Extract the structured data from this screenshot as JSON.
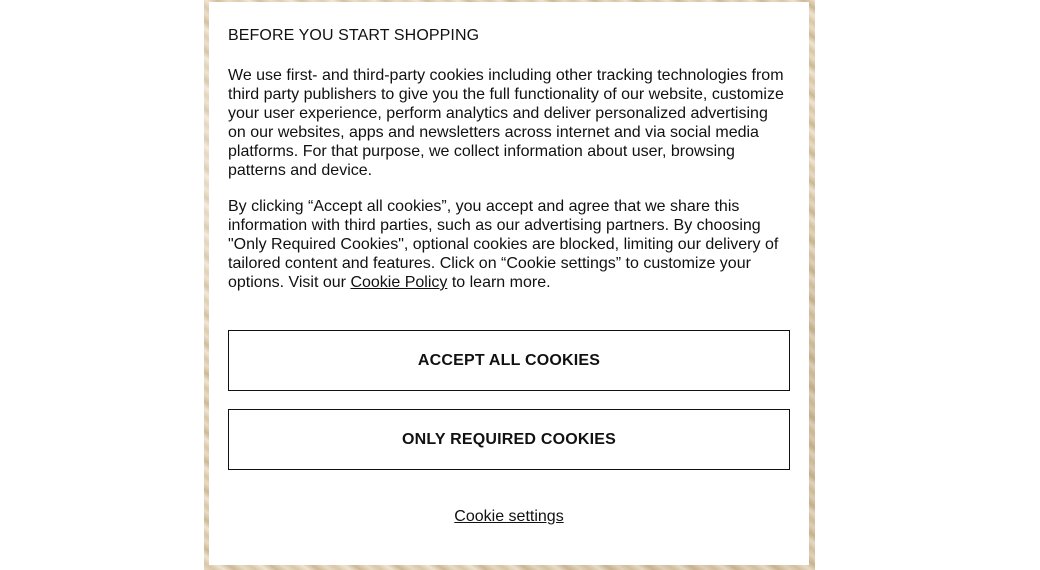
{
  "cookie_banner": {
    "title": "BEFORE YOU START SHOPPING",
    "paragraph_1": "We use first- and third-party cookies including other tracking technologies from third party publishers to give you the full functionality of our website, customize your user experience, perform analytics and deliver personalized advertising on our websites, apps and newsletters across internet and via social media platforms. For that purpose, we collect information about user, browsing patterns and device.",
    "paragraph_2_before_link": "By clicking “Accept all cookies”, you accept and agree that we share this information with third parties, such as our advertising partners. By choosing \"Only Required Cookies\", optional cookies are blocked, limiting our delivery of tailored content and features. Click on “Cookie settings” to customize your options. Visit our ",
    "cookie_policy_link": "Cookie Policy",
    "paragraph_2_after_link": " to learn more.",
    "accept_all_label": "ACCEPT ALL COOKIES",
    "only_required_label": "ONLY REQUIRED COOKIES",
    "settings_label": "Cookie settings"
  },
  "colors": {
    "text": "#111111",
    "modal_background": "#ffffff",
    "button_border": "#111111"
  }
}
